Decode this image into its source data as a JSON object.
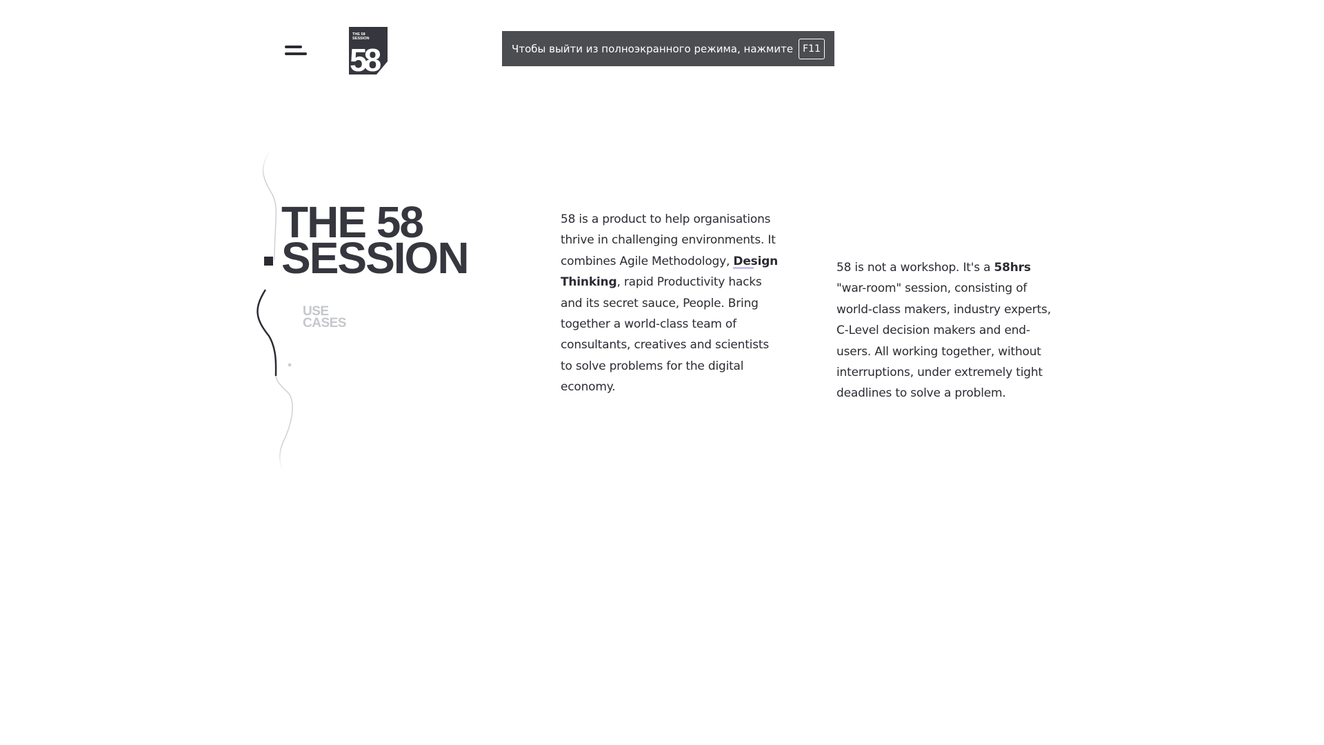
{
  "header": {
    "menu_icon": "hamburger-menu-icon",
    "logo": {
      "line1": "THE 58",
      "line2": "SESSION",
      "mark": "58",
      "background": "#36373e"
    }
  },
  "fullscreen_notice": {
    "text": "Чтобы выйти из полноэкранного режима, нажмите",
    "key": "F11"
  },
  "hero": {
    "title_line1": "THE 58",
    "title_line2": "SESSION",
    "use_cases_line1": "USE",
    "use_cases_line2": "CASES"
  },
  "column1": {
    "part1": "58 is a product to help organisations thrive in challenging environments. It combines Agile Methodology,",
    "link": "Design Thinking",
    "part2": ", rapid Productivity hacks and its secret sauce, People. Bring together a world-class team of consultants, creatives and scientists to solve problems for the digital economy."
  },
  "column2": {
    "part1": "58 is not a workshop. It's a",
    "bold": "58hrs",
    "part2": "\"war-room\" session, consisting of world-class makers, industry experts, C-Level decision makers and end-users. All working together, without interruptions, under extremely tight deadlines to solve a problem."
  },
  "colors": {
    "text": "#2b2c33",
    "title": "#36373e",
    "muted": "#c5c7cc",
    "notice_bg": "#4b4d51",
    "link_underline": "#7a6bd6"
  }
}
